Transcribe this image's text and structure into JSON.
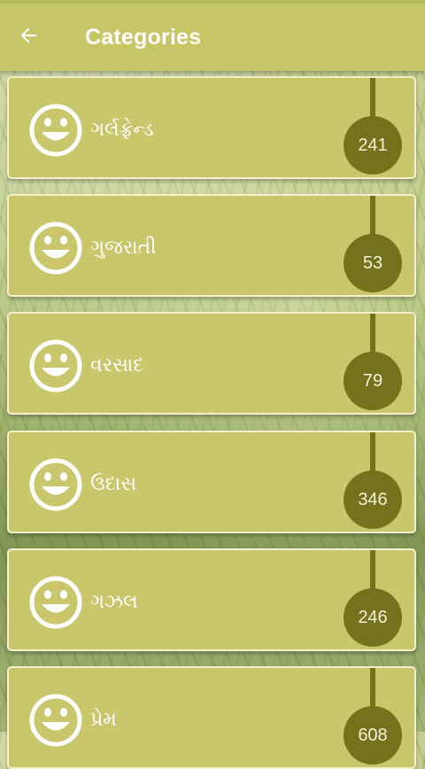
{
  "app_bar": {
    "title": "Categories",
    "back_icon": "arrow-left-icon",
    "color": "#c7c666"
  },
  "categories": [
    {
      "label": "ગર્લફ્રેન્ડ",
      "count": "241",
      "icon": "smiley-icon"
    },
    {
      "label": "ગુજરાતી",
      "count": "53",
      "icon": "smiley-icon"
    },
    {
      "label": "વરસાદ",
      "count": "79",
      "icon": "smiley-icon"
    },
    {
      "label": "ઉદાસ",
      "count": "346",
      "icon": "smiley-icon"
    },
    {
      "label": "ગઝલ",
      "count": "246",
      "icon": "smiley-icon"
    },
    {
      "label": "પ્રેમ",
      "count": "608",
      "icon": "smiley-icon"
    }
  ],
  "colors": {
    "card": "#c9c66b",
    "badge": "#74721c",
    "text": "#ffffff"
  }
}
